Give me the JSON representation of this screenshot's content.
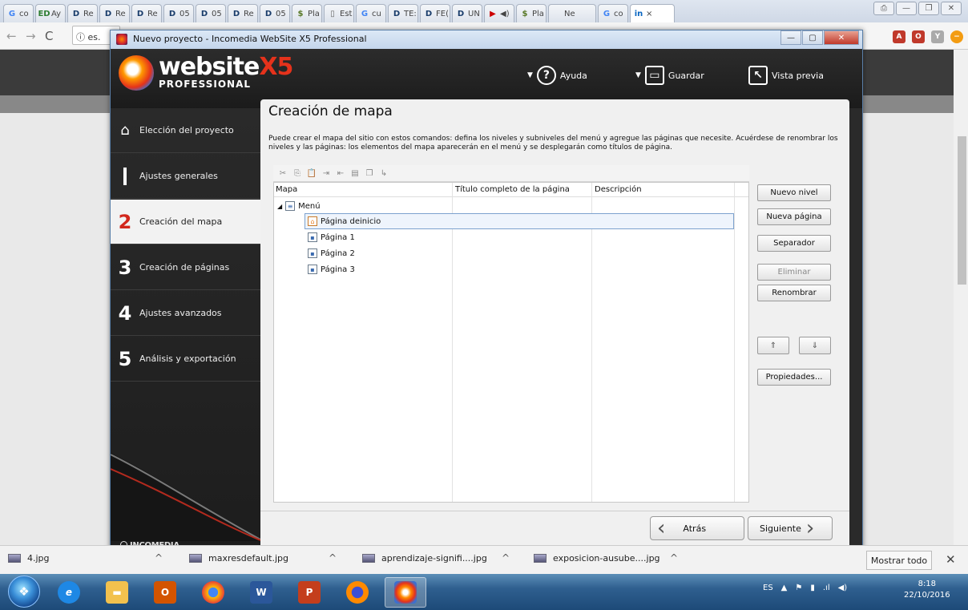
{
  "browser": {
    "tabs": [
      {
        "icon": "G",
        "label": "co",
        "color": "#4285f4"
      },
      {
        "icon": "ED",
        "label": "Ay",
        "color": "#2e7d32"
      },
      {
        "icon": "D",
        "label": "Re",
        "color": "#1a3d6b"
      },
      {
        "icon": "D",
        "label": "Re",
        "color": "#1a3d6b"
      },
      {
        "icon": "D",
        "label": "Re",
        "color": "#1a3d6b"
      },
      {
        "icon": "D",
        "label": "05",
        "color": "#1a3d6b"
      },
      {
        "icon": "D",
        "label": "05",
        "color": "#1a3d6b"
      },
      {
        "icon": "D",
        "label": "Re",
        "color": "#1a3d6b"
      },
      {
        "icon": "D",
        "label": "05",
        "color": "#1a3d6b"
      },
      {
        "icon": "$",
        "label": "Pla",
        "color": "#5a7a2a"
      },
      {
        "icon": "▯",
        "label": "Est",
        "color": "#666"
      },
      {
        "icon": "G",
        "label": "cu",
        "color": "#4285f4"
      },
      {
        "icon": "D",
        "label": "TE:",
        "color": "#1a3d6b"
      },
      {
        "icon": "D",
        "label": "FE(",
        "color": "#1a3d6b"
      },
      {
        "icon": "D",
        "label": "UN",
        "color": "#1a3d6b"
      },
      {
        "icon": "▶",
        "label": "◀)",
        "color": "#c00"
      },
      {
        "icon": "$",
        "label": "Pla",
        "color": "#5a7a2a"
      },
      {
        "icon": "",
        "label": "Ne",
        "color": "#666"
      },
      {
        "icon": "G",
        "label": "co",
        "color": "#4285f4"
      },
      {
        "icon": "in",
        "label": "×",
        "color": "#0a66c2"
      }
    ],
    "address": "es.",
    "window_buttons": [
      "⎙",
      "—",
      "❐",
      "✕"
    ]
  },
  "app": {
    "title": "Nuevo proyecto - Incomedia WebSite X5 Professional",
    "brand_main": "website",
    "brand_x5": "X5",
    "brand_sub": "PROFESSIONAL",
    "header_buttons": {
      "help": "Ayuda",
      "save": "Guardar",
      "preview": "Vista previa"
    },
    "window_buttons": {
      "minimize": "—",
      "maximize": "▢",
      "close": "✕"
    }
  },
  "sidebar": {
    "items": [
      {
        "num": "",
        "label": "Elección del proyecto"
      },
      {
        "num": "1",
        "label": "Ajustes generales"
      },
      {
        "num": "2",
        "label": "Creación del mapa"
      },
      {
        "num": "3",
        "label": "Creación de páginas"
      },
      {
        "num": "4",
        "label": "Ajustes avanzados"
      },
      {
        "num": "5",
        "label": "Análisis y exportación"
      }
    ],
    "footer": "INCOMEDIA"
  },
  "main": {
    "title": "Creación de mapa",
    "description": "Puede crear el mapa del sitio con estos comandos: defina los niveles y subniveles del menú y agregue las páginas que necesite. Acuérdese de renombrar los niveles y las páginas: los elementos del mapa aparecerán en el menú y se desplegarán como títulos de página.",
    "columns": [
      "Mapa",
      "Título completo de la página",
      "Descripción"
    ],
    "tree": [
      {
        "label": "Menú",
        "level": 0,
        "type": "folder"
      },
      {
        "label": "Página deinicio",
        "level": 1,
        "type": "home",
        "selected": true
      },
      {
        "label": "Página 1",
        "level": 1,
        "type": "page"
      },
      {
        "label": "Página 2",
        "level": 1,
        "type": "page"
      },
      {
        "label": "Página 3",
        "level": 1,
        "type": "page"
      }
    ],
    "buttons": {
      "new_level": "Nuevo nivel",
      "new_page": "Nueva página",
      "separator": "Separador",
      "delete": "Eliminar",
      "rename": "Renombrar",
      "properties": "Propiedades...",
      "up": "⇑",
      "down": "⇓"
    },
    "nav": {
      "back": "Atrás",
      "next": "Siguiente"
    }
  },
  "downloads": {
    "items": [
      "4.jpg",
      "maxresdefault.jpg",
      "aprendizaje-signifi....jpg",
      "exposicion-ausube....jpg"
    ],
    "show_all": "Mostrar todo",
    "close": "✕"
  },
  "taskbar": {
    "language": "ES",
    "time": "8:18",
    "date": "22/10/2016"
  }
}
